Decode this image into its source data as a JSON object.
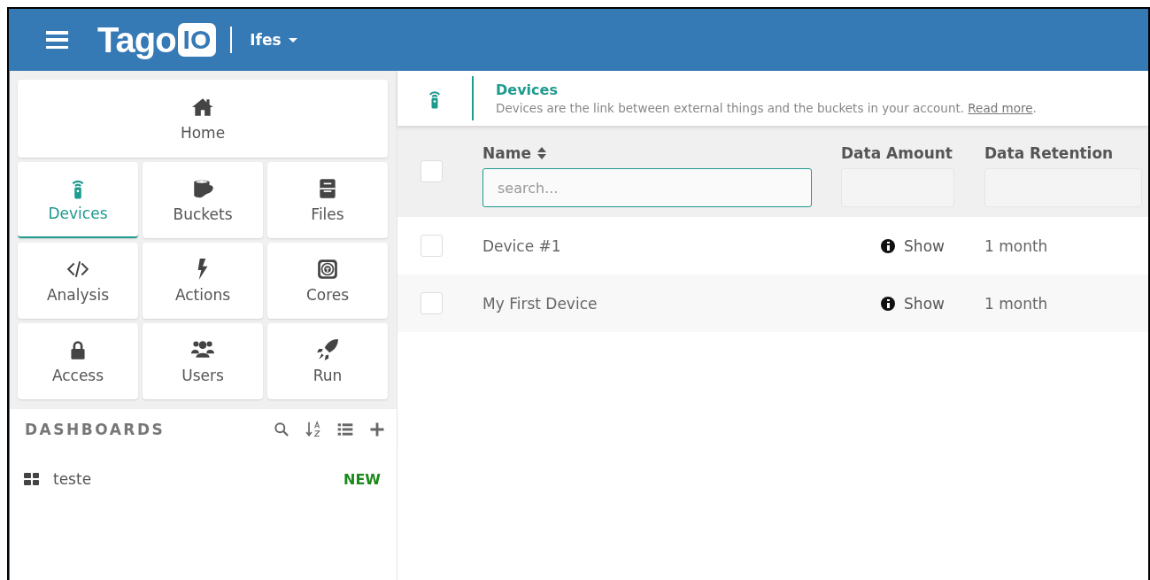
{
  "header": {
    "logo_text": "Tago",
    "logo_badge": "IO",
    "organization": "Ifes"
  },
  "sidebar": {
    "tiles": [
      {
        "label": "Home",
        "kind": "home",
        "selected": false
      },
      {
        "label": "Devices",
        "kind": "device",
        "selected": true
      },
      {
        "label": "Buckets",
        "kind": "bucket",
        "selected": false
      },
      {
        "label": "Files",
        "kind": "files",
        "selected": false
      },
      {
        "label": "Analysis",
        "kind": "code",
        "selected": false
      },
      {
        "label": "Actions",
        "kind": "bolt",
        "selected": false
      },
      {
        "label": "Cores",
        "kind": "core",
        "selected": false
      },
      {
        "label": "Access",
        "kind": "lock",
        "selected": false
      },
      {
        "label": "Users",
        "kind": "users",
        "selected": false
      },
      {
        "label": "Run",
        "kind": "rocket",
        "selected": false
      }
    ],
    "dashboards": {
      "title": "DASHBOARDS",
      "items": [
        {
          "name": "teste",
          "badge": "NEW"
        }
      ]
    }
  },
  "page_header": {
    "title": "Devices",
    "description": "Devices are the link between external things and the buckets in your account.",
    "link": "Read more",
    "description_end": "."
  },
  "table": {
    "header_checked": false,
    "columns": [
      {
        "label": "Name",
        "sortable": true,
        "filter_placeholder": "search..."
      },
      {
        "label": "Data Amount",
        "sortable": false
      },
      {
        "label": "Data Retention",
        "sortable": false
      }
    ],
    "rows": [
      {
        "checked": false,
        "name": "Device #1",
        "data_amount": "Show",
        "data_retention": "1 month"
      },
      {
        "checked": false,
        "name": "My First Device",
        "data_amount": "Show",
        "data_retention": "1 month"
      }
    ]
  }
}
